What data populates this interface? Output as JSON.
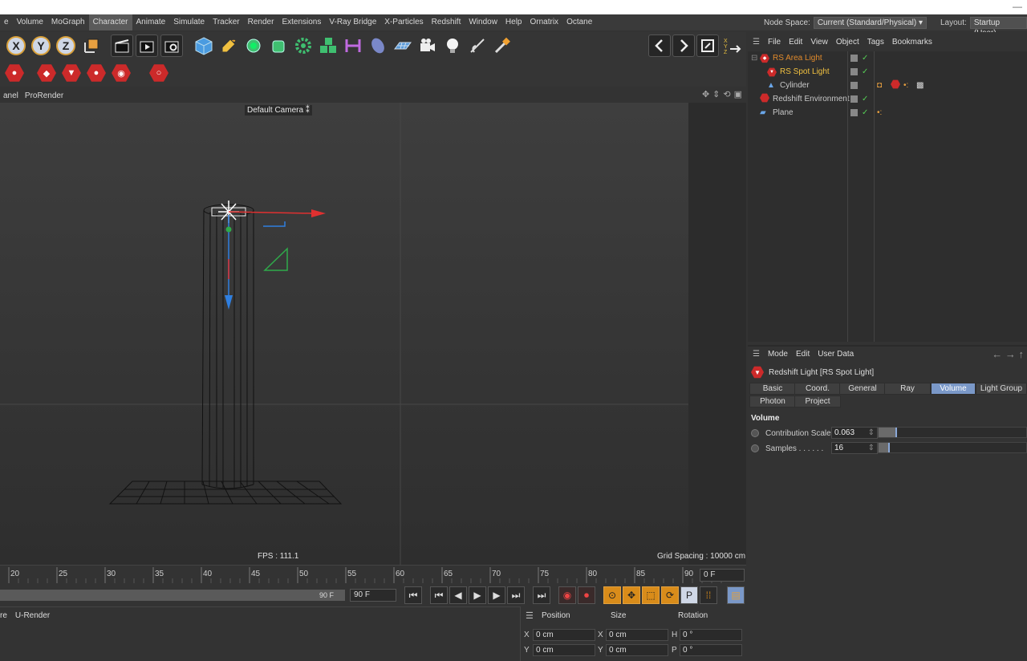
{
  "menubar": {
    "items": [
      "e",
      "Volume",
      "MoGraph",
      "Character",
      "Animate",
      "Simulate",
      "Tracker",
      "Render",
      "Extensions",
      "V-Ray Bridge",
      "X-Particles",
      "Redshift",
      "Window",
      "Help",
      "Ornatrix",
      "Octane"
    ],
    "active_index": 3
  },
  "nodespace": {
    "label": "Node Space:",
    "value": "Current (Standard/Physical)"
  },
  "layout": {
    "label": "Layout:",
    "value": "Startup (User)"
  },
  "toolbar": {
    "axis_x": "X",
    "axis_y": "Y",
    "axis_z": "Z"
  },
  "viewport": {
    "menu_items": [
      "anel",
      "ProRender"
    ],
    "camera_label": "Default Camera",
    "fps": "FPS : 111.1",
    "grid_spacing": "Grid Spacing : 10000 cm"
  },
  "timeline": {
    "ticks": [
      "20",
      "25",
      "30",
      "35",
      "40",
      "45",
      "50",
      "55",
      "60",
      "65",
      "70",
      "75",
      "80",
      "85",
      "90"
    ],
    "current_frame": "0 F",
    "range_end": "90 F",
    "end_field": "90 F"
  },
  "bottom_left": {
    "tabs": [
      "re",
      "U-Render"
    ]
  },
  "coordinates": {
    "headers": {
      "position": "Position",
      "size": "Size",
      "rotation": "Rotation"
    },
    "rows": [
      {
        "axis": "X",
        "pos": "0 cm",
        "size_axis": "X",
        "size": "0 cm",
        "rot_axis": "H",
        "rot": "0 °"
      },
      {
        "axis": "Y",
        "pos": "0 cm",
        "size_axis": "Y",
        "size": "0 cm",
        "rot_axis": "P",
        "rot": "0 °"
      }
    ]
  },
  "object_manager": {
    "menu": [
      "File",
      "Edit",
      "View",
      "Object",
      "Tags",
      "Bookmarks"
    ],
    "objects": [
      {
        "name": "RS Area Light",
        "color": "#e08a2c"
      },
      {
        "name": "RS Spot Light",
        "color": "#f0c040"
      },
      {
        "name": "Cylinder",
        "color": "#d0d0d0"
      },
      {
        "name": "Redshift Environment",
        "color": "#d0d0d0"
      },
      {
        "name": "Plane",
        "color": "#d0d0d0"
      }
    ]
  },
  "attribute_manager": {
    "menu": [
      "Mode",
      "Edit",
      "User Data"
    ],
    "title": "Redshift Light [RS Spot Light]",
    "tabs_row1": [
      "Basic",
      "Coord.",
      "General",
      "Ray",
      "Volume",
      "Light Group"
    ],
    "tabs_row2": [
      "Photon",
      "Project"
    ],
    "active_tab": "Volume",
    "section": "Volume",
    "params": [
      {
        "label": "Contribution Scale",
        "value": "0.063",
        "fraction": 0.063
      },
      {
        "label": "Samples . . . . . .",
        "value": "16",
        "fraction": 0.016
      }
    ]
  },
  "colors": {
    "accent_blue": "#7a98c8",
    "axis_red": "#e03030",
    "axis_green": "#2faa4a",
    "axis_blue": "#2f7fe0"
  }
}
